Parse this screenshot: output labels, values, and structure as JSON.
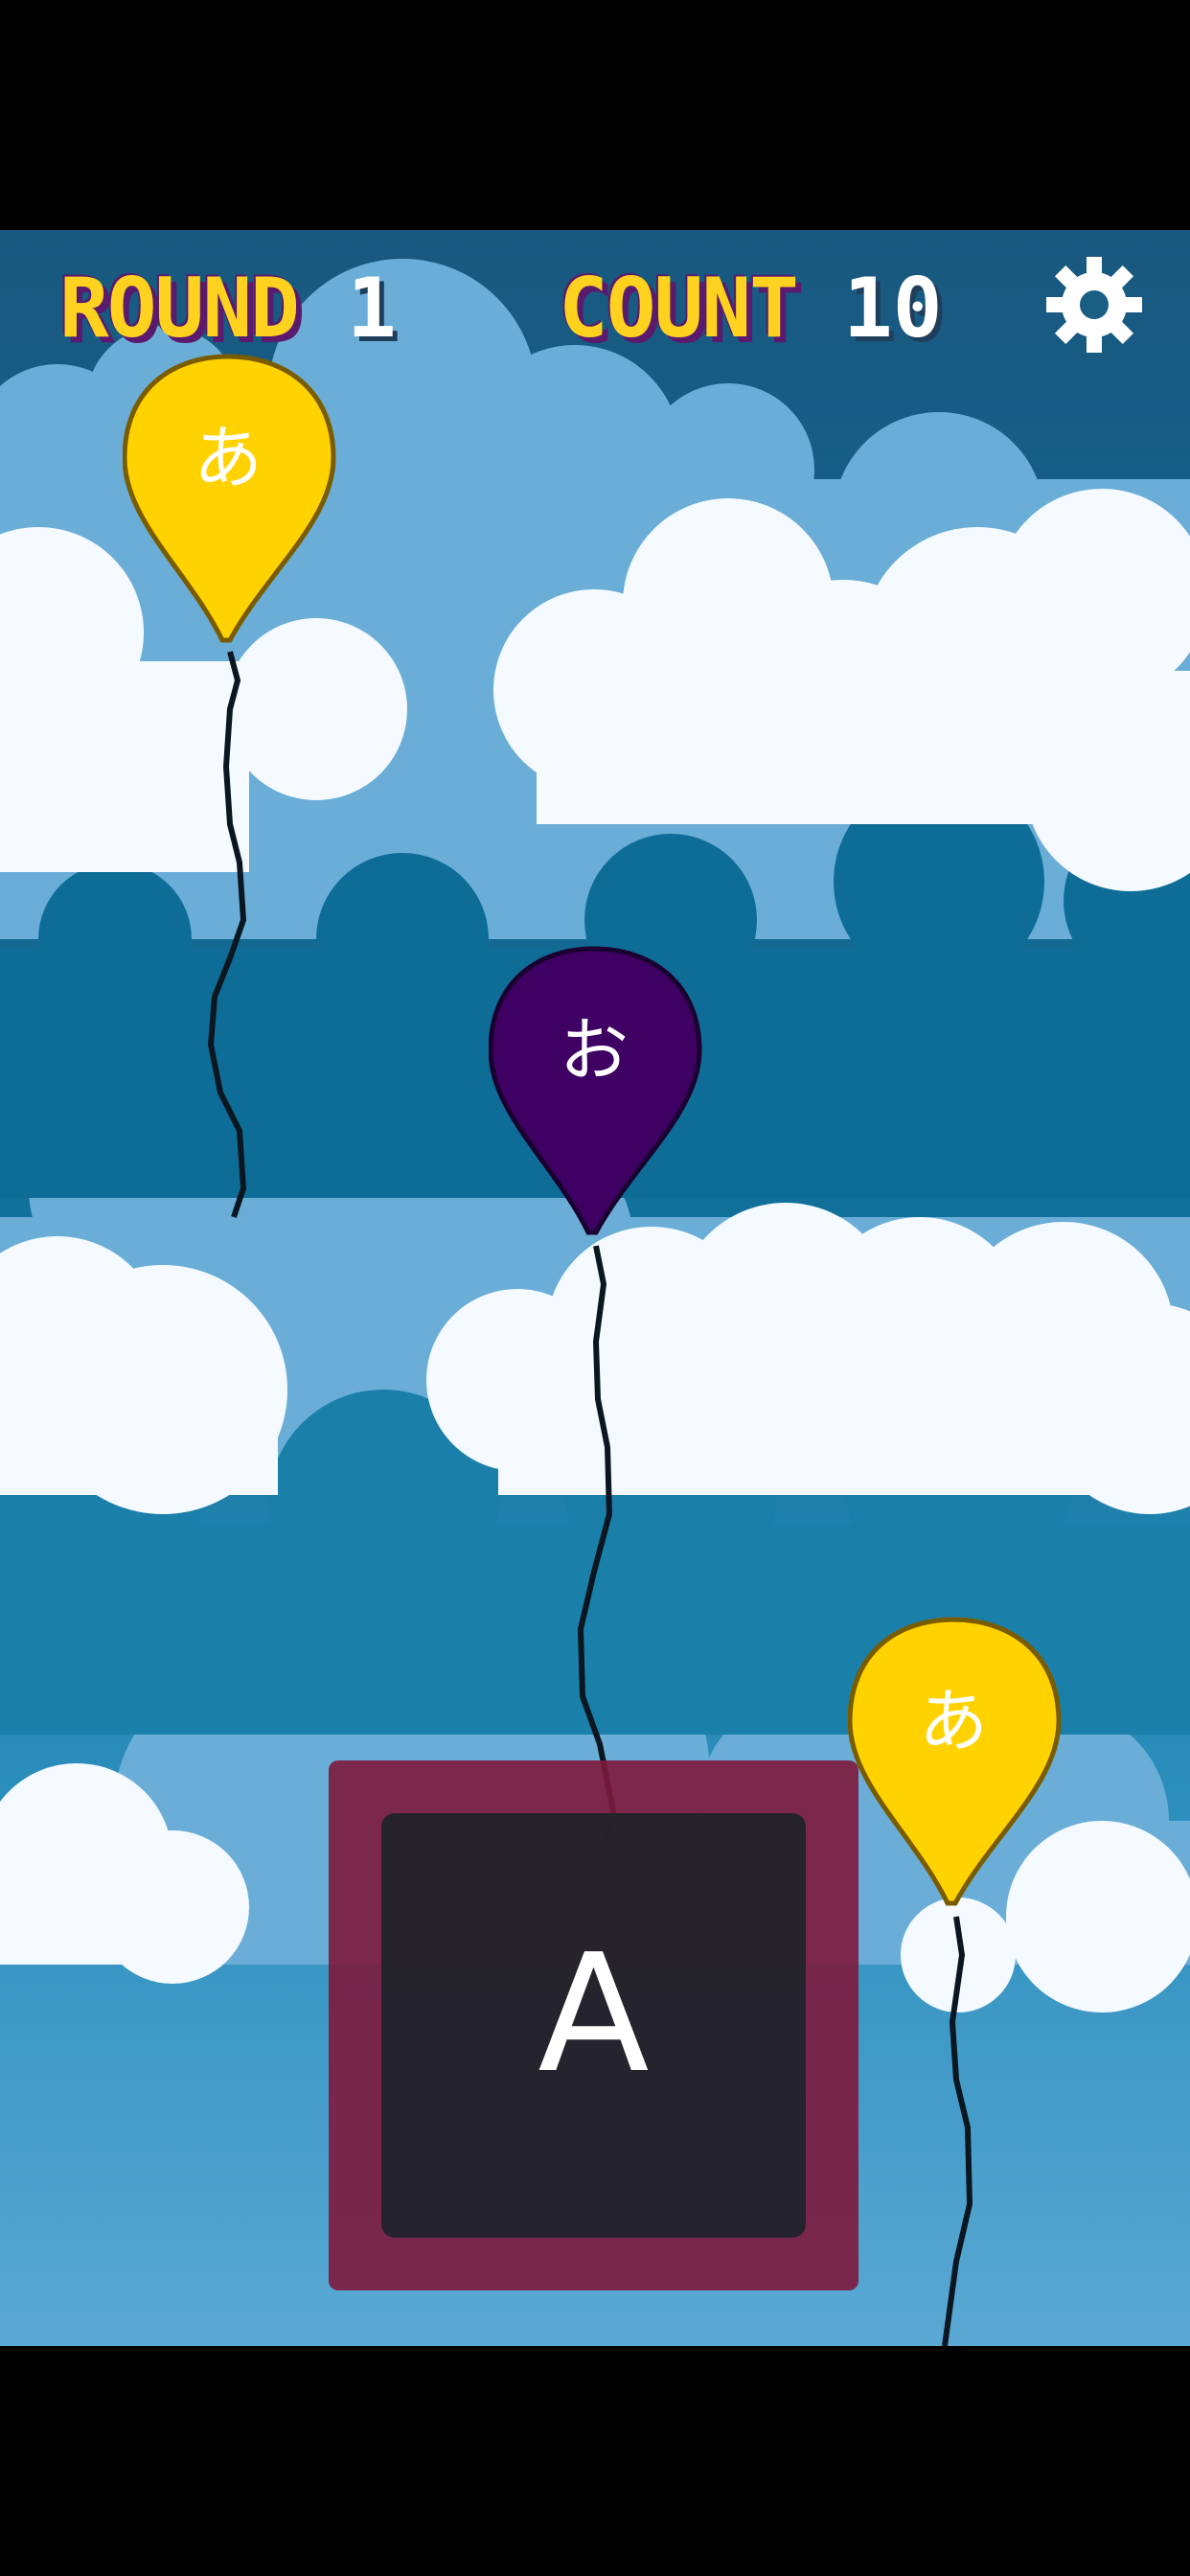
{
  "hud": {
    "round_label": "ROUND",
    "round_value": "1",
    "count_label": "COUNT",
    "count_value": "10",
    "settings_icon": "gear-icon"
  },
  "balloons": [
    {
      "glyph": "あ",
      "color": "#FFD200"
    },
    {
      "glyph": "お",
      "color": "#3E0063"
    },
    {
      "glyph": "あ",
      "color": "#FFD200"
    }
  ],
  "answer": {
    "letter": "A"
  },
  "colors": {
    "sky_dark": "#1B5E84",
    "sky_mid": "#1B7CA3",
    "cloud_blue": "#6AAED8",
    "cloud_white": "#F4FAFF",
    "hud_yellow": "#FFD21F",
    "panel_border": "#7D193C",
    "panel_inner": "#1E232A"
  }
}
